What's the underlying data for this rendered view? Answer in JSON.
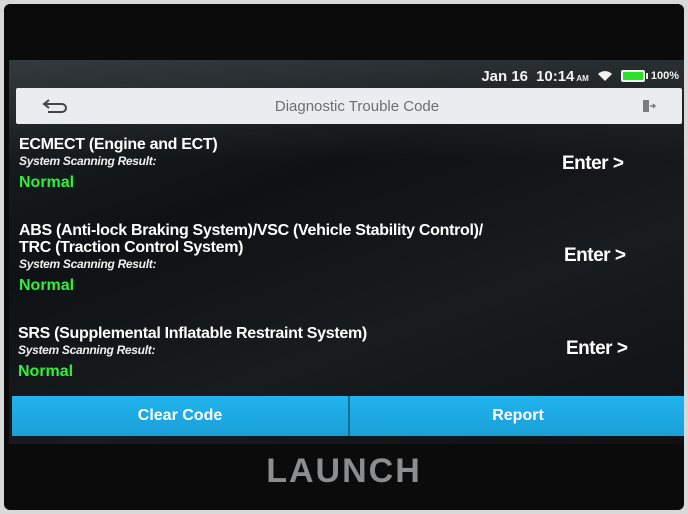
{
  "status_bar": {
    "date": "Jan 16",
    "time": "10:14",
    "ampm": "AM",
    "battery": "100%",
    "battery_color": "#2ee02e"
  },
  "header": {
    "title": "Diagnostic Trouble Code",
    "back_icon": "back-arrow-icon",
    "exit_icon": "exit-icon"
  },
  "systems": [
    {
      "name": "ECMECT (Engine and ECT)",
      "result_label": "System Scanning Result:",
      "result": "Normal",
      "enter_label": "Enter >"
    },
    {
      "name_line1": "ABS (Anti-lock Braking System)/VSC (Vehicle Stability Control)/",
      "name_line2": "TRC (Traction Control System)",
      "result_label": "System Scanning Result:",
      "result": "Normal",
      "enter_label": "Enter >"
    },
    {
      "name": "SRS (Supplemental Inflatable Restraint System)",
      "result_label": "System Scanning Result:",
      "result": "Normal",
      "enter_label": "Enter >"
    }
  ],
  "actions": {
    "clear_code": "Clear Code",
    "report": "Report"
  },
  "brand": "LAUNCH",
  "colors": {
    "accent": "#1aa6df",
    "normal_status": "#2df23a"
  }
}
